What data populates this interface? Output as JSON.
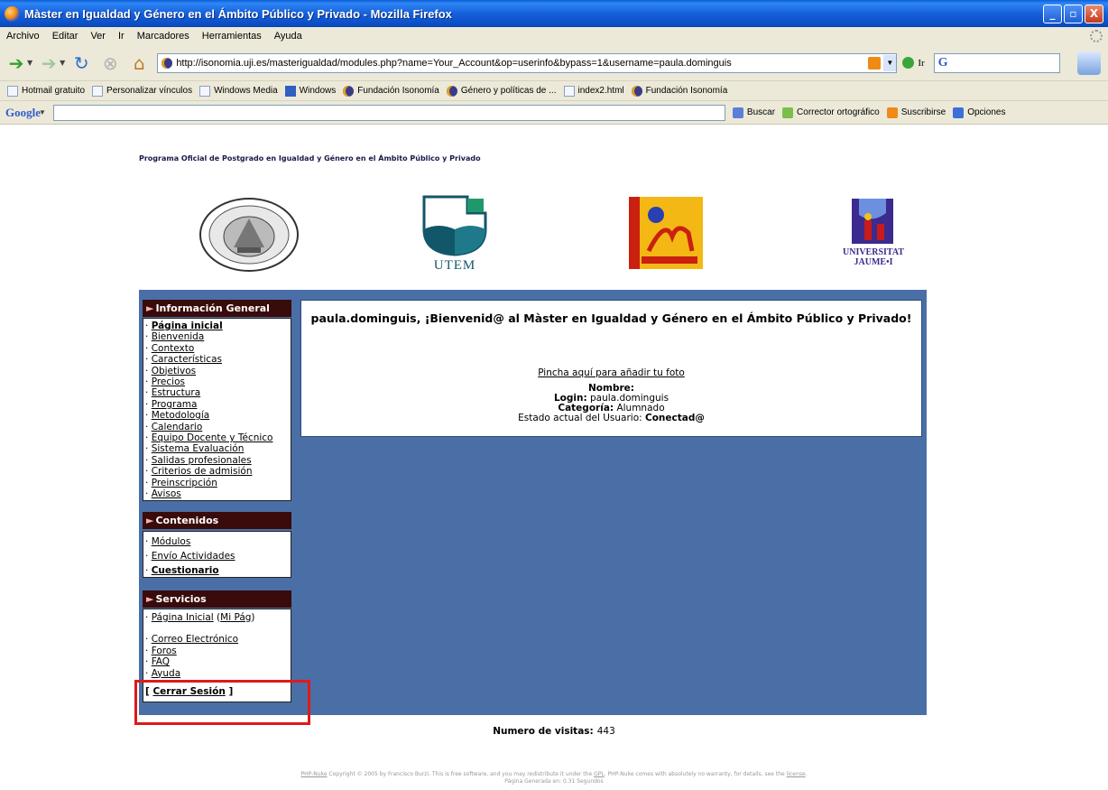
{
  "window": {
    "title": "Màster en Igualdad y Género en el Ámbito Público y Privado - Mozilla Firefox",
    "minimize": "_",
    "maximize": "▫",
    "close": "X"
  },
  "menu": {
    "items": [
      "Archivo",
      "Editar",
      "Ver",
      "Ir",
      "Marcadores",
      "Herramientas",
      "Ayuda"
    ]
  },
  "navigation": {
    "url": "http://isonomia.uji.es/masterigualdad/modules.php?name=Your_Account&op=userinfo&bypass=1&username=paula.dominguis",
    "go_label": "Ir",
    "search_logo": "G"
  },
  "bookmarks": [
    "Hotmail gratuito",
    "Personalizar vínculos",
    "Windows Media",
    "Windows",
    "Fundación Isonomía",
    "Género y políticas de ...",
    "index2.html",
    "Fundación Isonomía"
  ],
  "google_toolbar": {
    "logo": "Google",
    "buscar": "Buscar",
    "corrector": "Corrector ortográfico",
    "suscribirse": "Suscribirse",
    "opciones": "Opciones"
  },
  "header": {
    "program_title": "Programa Oficial de Postgrado en Igualdad y Género en el Ámbito Público y Privado",
    "logos": {
      "utem": "UTEM",
      "uji_line1": "UNIVERSITAT",
      "uji_line2": "JAUME•I"
    }
  },
  "sidebar": {
    "info_general": {
      "title": "Información General",
      "items": [
        "Página inicial",
        "Bienvenida",
        "Contexto",
        "Características",
        "Objetivos",
        "Precios",
        "Estructura",
        "Programa",
        "Metodología",
        "Calendario",
        "Equipo Docente y Técnico",
        "Sistema Evaluación",
        "Salidas profesionales",
        "Criterios de admisión",
        "Preinscripción",
        "Avisos"
      ]
    },
    "contenidos": {
      "title": "Contenidos",
      "items": [
        "Módulos",
        "Envío Actividades",
        "Cuestionario"
      ]
    },
    "servicios": {
      "title": "Servicios",
      "pagina_inicial": "Página Inicial",
      "mi_pag": "Mi Pág",
      "items": [
        "Correo Electrónico",
        "Foros",
        "FAQ",
        "Ayuda"
      ],
      "logout_open": "[ ",
      "logout": "Cerrar Sesión",
      "logout_close": " ]"
    }
  },
  "profile": {
    "welcome": "paula.dominguis, ¡Bienvenid@ al Màster en Igualdad y Género en el Ámbito Público y Privado!",
    "photo_link": "Pincha aquí para añadir tu foto",
    "nombre_label": "Nombre:",
    "login_label": "Login:",
    "login_value": "paula.dominguis",
    "categoria_label": "Categoría:",
    "categoria_value": "Alumnado",
    "estado_label": "Estado actual del Usuario:",
    "estado_value": "Conectad@"
  },
  "visits": {
    "label": "Numero de visitas:",
    "value": "443"
  },
  "footer": {
    "phpnuke": "PHP-Nuke",
    "copyright": " Copyright © 2005 by Francisco Burzi. This is free software, and you may redistribute it under the ",
    "gpl": "GPL",
    "rest": ". PHP-Nuke comes with absolutely no warranty, for details, see the ",
    "license": "license",
    "end": ".",
    "generated": "Página Generada en: 0.31 Segundos"
  }
}
